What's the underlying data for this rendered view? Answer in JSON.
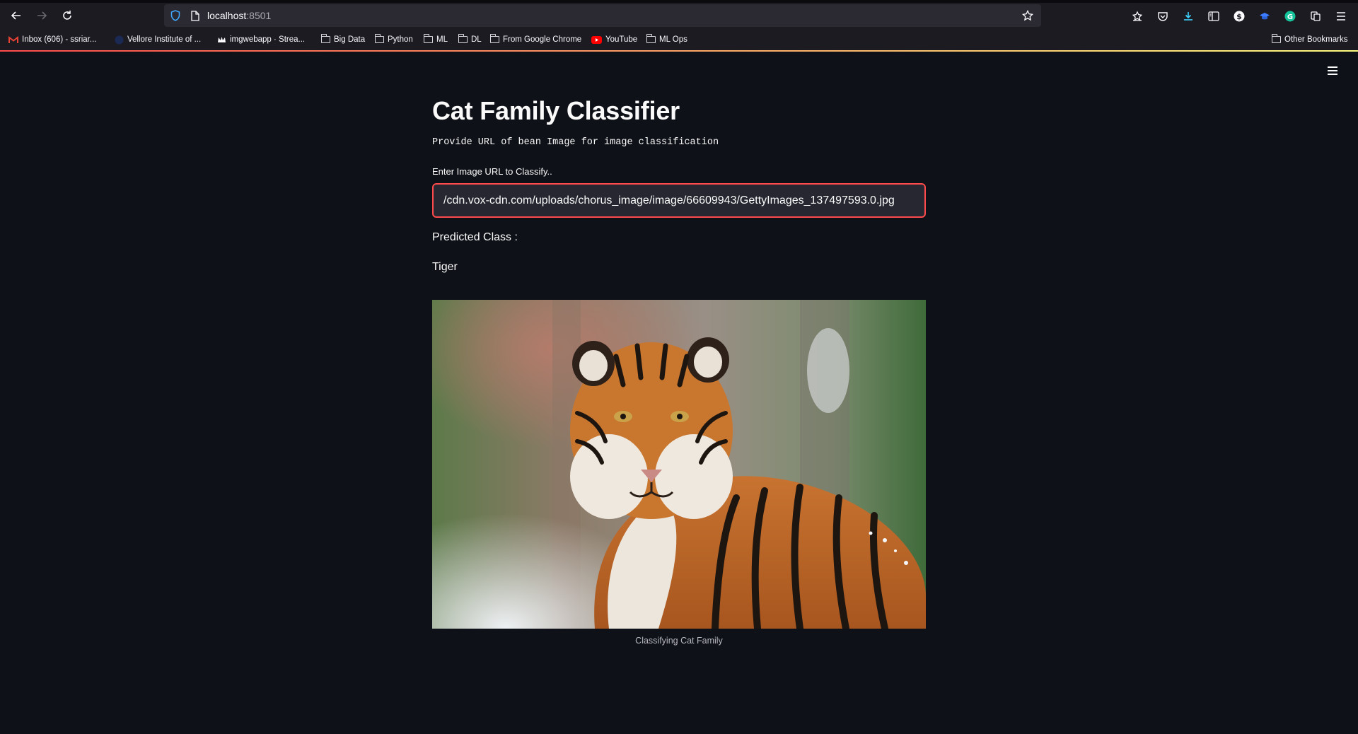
{
  "browser": {
    "url_host": "localhost",
    "url_port": ":8501",
    "bookmarks": [
      {
        "label": "Inbox (606) - ssriar...",
        "icon": "gmail-icon"
      },
      {
        "label": "Vellore Institute of ...",
        "icon": "site-favicon-icon"
      },
      {
        "label": "imgwebapp · Strea...",
        "icon": "streamlit-crown-icon"
      },
      {
        "label": "Big Data",
        "icon": "folder-icon"
      },
      {
        "label": "Python",
        "icon": "folder-icon"
      },
      {
        "label": "ML",
        "icon": "folder-icon"
      },
      {
        "label": "DL",
        "icon": "folder-icon"
      },
      {
        "label": "From Google Chrome",
        "icon": "folder-icon"
      },
      {
        "label": "YouTube",
        "icon": "youtube-icon"
      },
      {
        "label": "ML Ops",
        "icon": "folder-icon"
      }
    ],
    "other_bookmarks": "Other Bookmarks"
  },
  "app": {
    "title": "Cat Family Classifier",
    "subtitle": "Provide URL of bean Image for image classification",
    "input_label": "Enter Image URL to Classify..",
    "input_value": "/cdn.vox-cdn.com/uploads/chorus_image/image/66609943/GettyImages_137497593.0.jpg",
    "predicted_label": "Predicted Class :",
    "predicted_value": "Tiger",
    "image_caption": "Classifying Cat Family",
    "image_subject": "tiger-photo"
  },
  "colors": {
    "background": "#0e1117",
    "accent": "#ff4b4b",
    "input_bg": "#262730",
    "chrome_bg": "#1c1b22"
  }
}
